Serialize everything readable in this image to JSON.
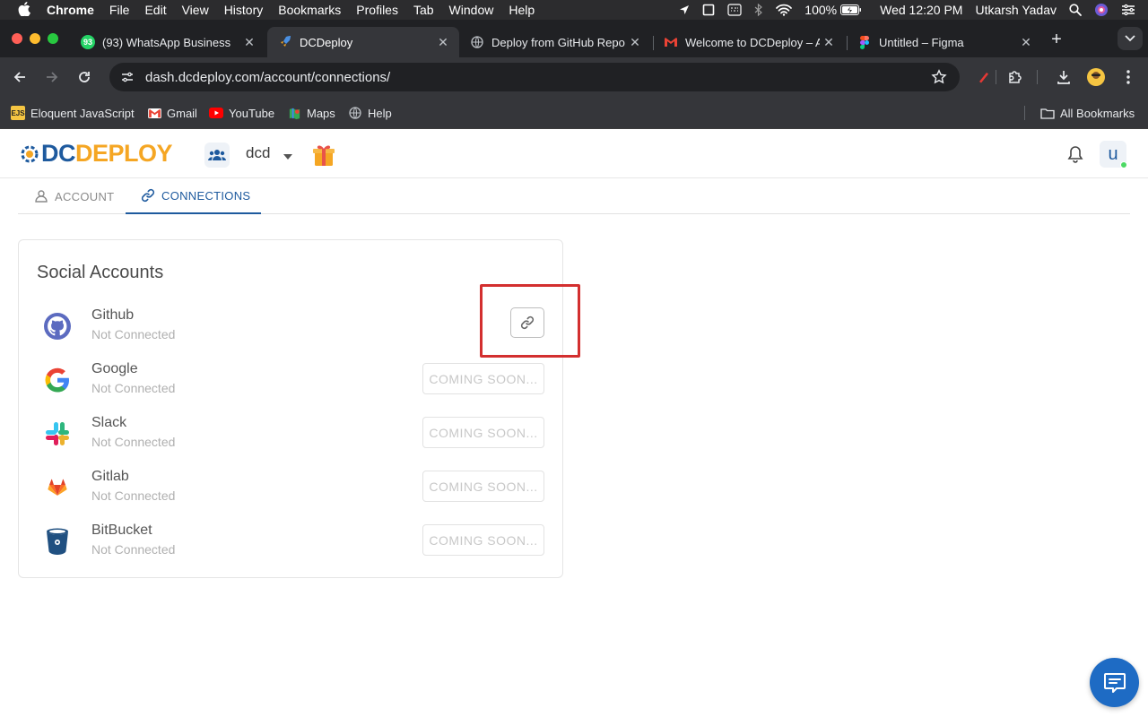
{
  "menubar": {
    "app": "Chrome",
    "items": [
      "File",
      "Edit",
      "View",
      "History",
      "Bookmarks",
      "Profiles",
      "Tab",
      "Window",
      "Help"
    ],
    "battery": "100%",
    "datetime": "Wed 12:20 PM",
    "user": "Utkarsh Yadav"
  },
  "tabs": [
    {
      "title": "(93) WhatsApp Business",
      "badge": "93"
    },
    {
      "title": "DCDeploy"
    },
    {
      "title": "Deploy from GitHub Repo"
    },
    {
      "title": "Welcome to DCDeploy – A"
    },
    {
      "title": "Untitled – Figma"
    }
  ],
  "omnibox": {
    "url": "dash.dcdeploy.com/account/connections/"
  },
  "bookmarks": {
    "items": [
      {
        "label": "Eloquent JavaScript",
        "icon_text": "EJS"
      },
      {
        "label": "Gmail"
      },
      {
        "label": "YouTube"
      },
      {
        "label": "Maps"
      },
      {
        "label": "Help"
      }
    ],
    "all": "All Bookmarks"
  },
  "app": {
    "logo_dc": "DC",
    "logo_deploy": "DEPLOY",
    "team_name": "dcd",
    "avatar_letter": "u"
  },
  "page_tabs": {
    "account": "ACCOUNT",
    "connections": "CONNECTIONS"
  },
  "social": {
    "title": "Social Accounts",
    "accounts": [
      {
        "name": "Github",
        "status": "Not Connected"
      },
      {
        "name": "Google",
        "status": "Not Connected",
        "action": "COMING SOON..."
      },
      {
        "name": "Slack",
        "status": "Not Connected",
        "action": "COMING SOON..."
      },
      {
        "name": "Gitlab",
        "status": "Not Connected",
        "action": "COMING SOON..."
      },
      {
        "name": "BitBucket",
        "status": "Not Connected",
        "action": "COMING SOON..."
      }
    ]
  },
  "colors": {
    "brand_blue": "#1e5a9e",
    "brand_orange": "#f5a623",
    "highlight_red": "#d32f2f"
  }
}
